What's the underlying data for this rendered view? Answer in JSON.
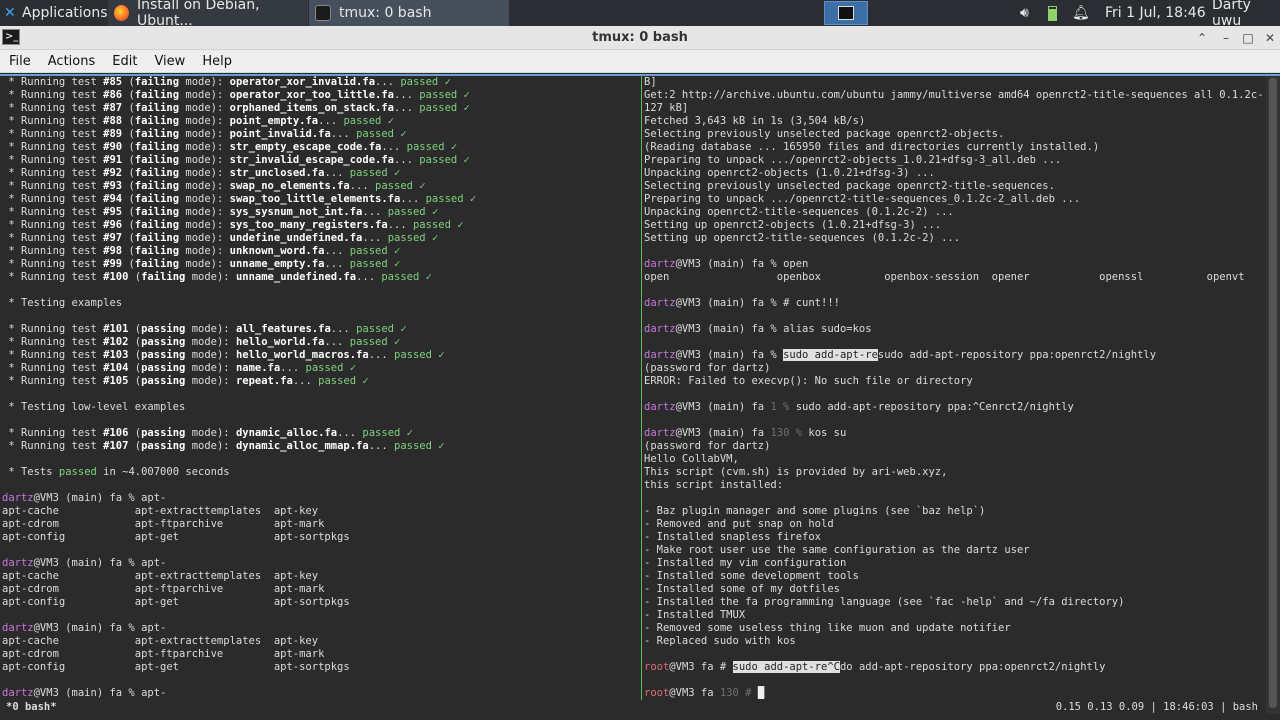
{
  "panel": {
    "applications_label": "Applications",
    "tasks": [
      {
        "label": "Install on Debian, Ubunt..."
      },
      {
        "label": "tmux: 0 bash"
      }
    ],
    "clock": "Fri  1 Jul, 18:46",
    "user": "Darty uwu"
  },
  "window": {
    "title": "tmux: 0 bash"
  },
  "menu": {
    "file": "File",
    "actions": "Actions",
    "edit": "Edit",
    "view": "View",
    "help": "Help"
  },
  "left_pane": {
    "lines": [
      " * Running test #85 (failing mode): operator_xor_invalid.fa... passed ✓",
      " * Running test #86 (failing mode): operator_xor_too_little.fa... passed ✓",
      " * Running test #87 (failing mode): orphaned_items_on_stack.fa... passed ✓",
      " * Running test #88 (failing mode): point_empty.fa... passed ✓",
      " * Running test #89 (failing mode): point_invalid.fa... passed ✓",
      " * Running test #90 (failing mode): str_empty_escape_code.fa... passed ✓",
      " * Running test #91 (failing mode): str_invalid_escape_code.fa... passed ✓",
      " * Running test #92 (failing mode): str_unclosed.fa... passed ✓",
      " * Running test #93 (failing mode): swap_no_elements.fa... passed ✓",
      " * Running test #94 (failing mode): swap_too_little_elements.fa... passed ✓",
      " * Running test #95 (failing mode): sys_sysnum_not_int.fa... passed ✓",
      " * Running test #96 (failing mode): sys_too_many_registers.fa... passed ✓",
      " * Running test #97 (failing mode): undefine_undefined.fa... passed ✓",
      " * Running test #98 (failing mode): unknown_word.fa... passed ✓",
      " * Running test #99 (failing mode): unname_empty.fa... passed ✓",
      " * Running test #100 (failing mode): unname_undefined.fa... passed ✓",
      "",
      " * Testing examples",
      "",
      " * Running test #101 (passing mode): all_features.fa... passed ✓",
      " * Running test #102 (passing mode): hello_world.fa... passed ✓",
      " * Running test #103 (passing mode): hello_world_macros.fa... passed ✓",
      " * Running test #104 (passing mode): name.fa... passed ✓",
      " * Running test #105 (passing mode): repeat.fa... passed ✓",
      "",
      " * Testing low-level examples",
      "",
      " * Running test #106 (passing mode): dynamic_alloc.fa... passed ✓",
      " * Running test #107 (passing mode): dynamic_alloc_mmap.fa... passed ✓",
      "",
      " * Tests passed in ~4.007000 seconds",
      "",
      "dartz@VM3 (main) fa % apt-",
      "apt-cache            apt-extracttemplates  apt-key",
      "apt-cdrom            apt-ftparchive        apt-mark",
      "apt-config           apt-get               apt-sortpkgs",
      "",
      "dartz@VM3 (main) fa % apt-",
      "apt-cache            apt-extracttemplates  apt-key",
      "apt-cdrom            apt-ftparchive        apt-mark",
      "apt-config           apt-get               apt-sortpkgs",
      "",
      "dartz@VM3 (main) fa % apt-",
      "apt-cache            apt-extracttemplates  apt-key",
      "apt-cdrom            apt-ftparchive        apt-mark",
      "apt-config           apt-get               apt-sortpkgs",
      "",
      "dartz@VM3 (main) fa % apt-"
    ]
  },
  "right_pane": {
    "lines": [
      "B]",
      "Get:2 http://archive.ubuntu.com/ubuntu jammy/multiverse amd64 openrct2-title-sequences all 0.1.2c-2 [3,",
      "127 kB]",
      "Fetched 3,643 kB in 1s (3,504 kB/s)",
      "Selecting previously unselected package openrct2-objects.",
      "(Reading database ... 165950 files and directories currently installed.)",
      "Preparing to unpack .../openrct2-objects_1.0.21+dfsg-3_all.deb ...",
      "Unpacking openrct2-objects (1.0.21+dfsg-3) ...",
      "Selecting previously unselected package openrct2-title-sequences.",
      "Preparing to unpack .../openrct2-title-sequences_0.1.2c-2_all.deb ...",
      "Unpacking openrct2-title-sequences (0.1.2c-2) ...",
      "Setting up openrct2-objects (1.0.21+dfsg-3) ...",
      "Setting up openrct2-title-sequences (0.1.2c-2) ...",
      "",
      "dartz@VM3 (main) fa % open",
      "open                 openbox          openbox-session  opener           openssl          openvt",
      "",
      "dartz@VM3 (main) fa % # cunt!!!",
      "",
      "dartz@VM3 (main) fa % alias sudo=kos",
      "",
      "dartz@VM3 (main) fa % sudo add-apt-resudo add-apt-repository ppa:openrct2/nightly",
      "(password for dartz)",
      "ERROR: Failed to execvp(): No such file or directory",
      "",
      "dartz@VM3 (main) fa 1 % sudo add-apt-repository ppa:^Cenrct2/nightly",
      "",
      "dartz@VM3 (main) fa 130 % kos su",
      "(password for dartz)",
      "Hello CollabVM,",
      "This script (cvm.sh) is provided by ari-web.xyz,",
      "this script installed:",
      "",
      "- Baz plugin manager and some plugins (see `baz help`)",
      "- Removed and put snap on hold",
      "- Installed snapless firefox",
      "- Make root user use the same configuration as the dartz user",
      "- Installed my vim configuration",
      "- Installed some development tools",
      "- Installed some of my dotfiles",
      "- Installed the fa programming language (see `fac -help` and ~/fa directory)",
      "- Installed TMUX",
      "- Removed some useless thing like muon and update notifier",
      "- Replaced sudo with kos",
      "",
      "root@VM3 fa # sudo add-apt-re^Cdo add-apt-repository ppa:openrct2/nightly",
      "",
      "root@VM3 fa 130 # "
    ]
  },
  "status": {
    "session": " *0 bash*",
    "right": "0.15 0.13 0.09 | 18:46:03 | bash"
  },
  "colors": {
    "terminal_bg": "#2b2b2b",
    "pass_green": "#7fd17f",
    "prompt_user": "#c678dd",
    "divider": "#5fb85f"
  }
}
